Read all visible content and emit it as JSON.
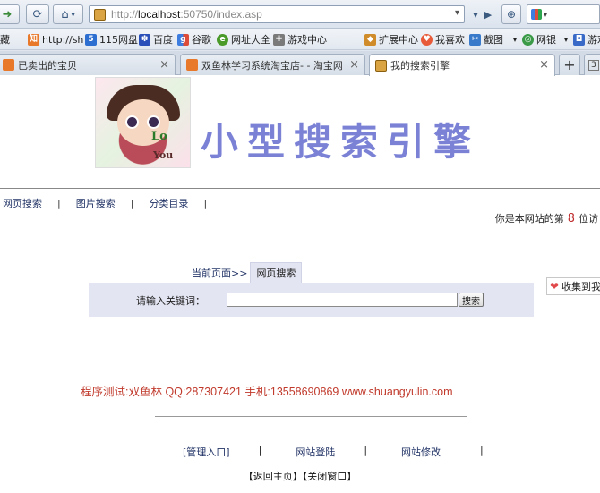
{
  "browser": {
    "url_prefix": "http://",
    "url_host": "localhost",
    "url_rest": ":50750/index.asp",
    "bookmarks": [
      {
        "label": "藏",
        "icon": "bookmark-star-icon"
      },
      {
        "label": "http://sh",
        "icon": "orange-site-icon"
      },
      {
        "label": "115网盘",
        "icon": "115-icon"
      },
      {
        "label": "百度",
        "icon": "baidu-paw-icon"
      },
      {
        "label": "谷歌",
        "icon": "google-icon"
      },
      {
        "label": "网址大全",
        "icon": "green-e-icon"
      },
      {
        "label": "游戏中心",
        "icon": "gamepad-icon"
      }
    ],
    "tools": [
      {
        "label": "扩展中心",
        "icon": "puzzle-icon"
      },
      {
        "label": "我喜欢",
        "icon": "heart-icon"
      },
      {
        "label": "截图",
        "icon": "scissors-icon"
      },
      {
        "label": "网银",
        "icon": "bank-icon"
      },
      {
        "label": "游戏",
        "icon": "game-icon"
      }
    ],
    "tabs": [
      {
        "title": "已卖出的宝贝",
        "active": false
      },
      {
        "title": "双鱼林学习系统淘宝店- - 淘宝网",
        "active": false
      },
      {
        "title": "我的搜索引擎",
        "active": true
      }
    ],
    "new_tab_symbol": "+",
    "tab_count": "3"
  },
  "site": {
    "title": "小型搜索引擎",
    "logo_text_1": "Lo",
    "logo_text_2": "You"
  },
  "menu": {
    "items": [
      "网页搜索",
      "图片搜索",
      "分类目录"
    ],
    "separator": "|"
  },
  "visits": {
    "prefix": "你是本网站的第",
    "count": "8",
    "suffix": "位访"
  },
  "search": {
    "crumb_label": "当前页面>>",
    "current": "网页搜索",
    "prompt": "请输入关键词：",
    "input_value": "",
    "button_label": "搜索"
  },
  "favorite": {
    "label": "收集到我"
  },
  "credit": "程序测试:双鱼林 QQ:287307421 手机:13558690869 www.shuangyulin.com",
  "footer": {
    "links": [
      "[管理入口]",
      "网站登陆",
      "网站修改"
    ],
    "separator": "|",
    "actions": "【返回主页】【关闭窗口】"
  },
  "colors": {
    "title": "#7b82d6",
    "credit": "#c0392b",
    "search_panel": "#e3e5f2",
    "visit_count": "#c03030"
  }
}
